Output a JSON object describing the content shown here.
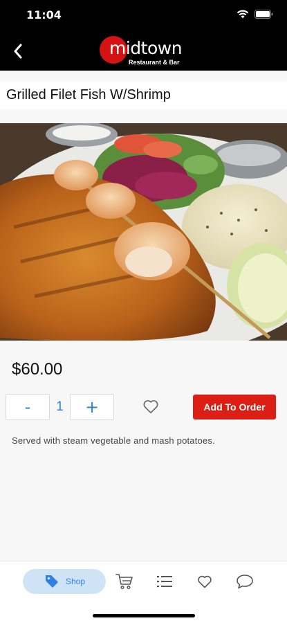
{
  "status_bar": {
    "time": "11:04"
  },
  "header": {
    "logo_word": "midtown",
    "logo_subtitle": "Restaurant & Bar",
    "brand_color": "#d41414"
  },
  "item": {
    "title": "Grilled Filet Fish W/Shrimp",
    "price": "$60.00",
    "quantity": "1",
    "minus_label": "-",
    "plus_label": "+",
    "add_to_order_label": "Add To Order",
    "description": "Served with steam vegetable and mash potatoes."
  },
  "tabs": {
    "shop_label": "Shop",
    "icons": [
      "tag-icon",
      "cart-icon",
      "list-icon",
      "heart-icon",
      "chat-icon"
    ]
  },
  "colors": {
    "accent": "#2f80e4",
    "cta": "#dc1e14",
    "tab_active_bg": "#cfe3f7"
  }
}
